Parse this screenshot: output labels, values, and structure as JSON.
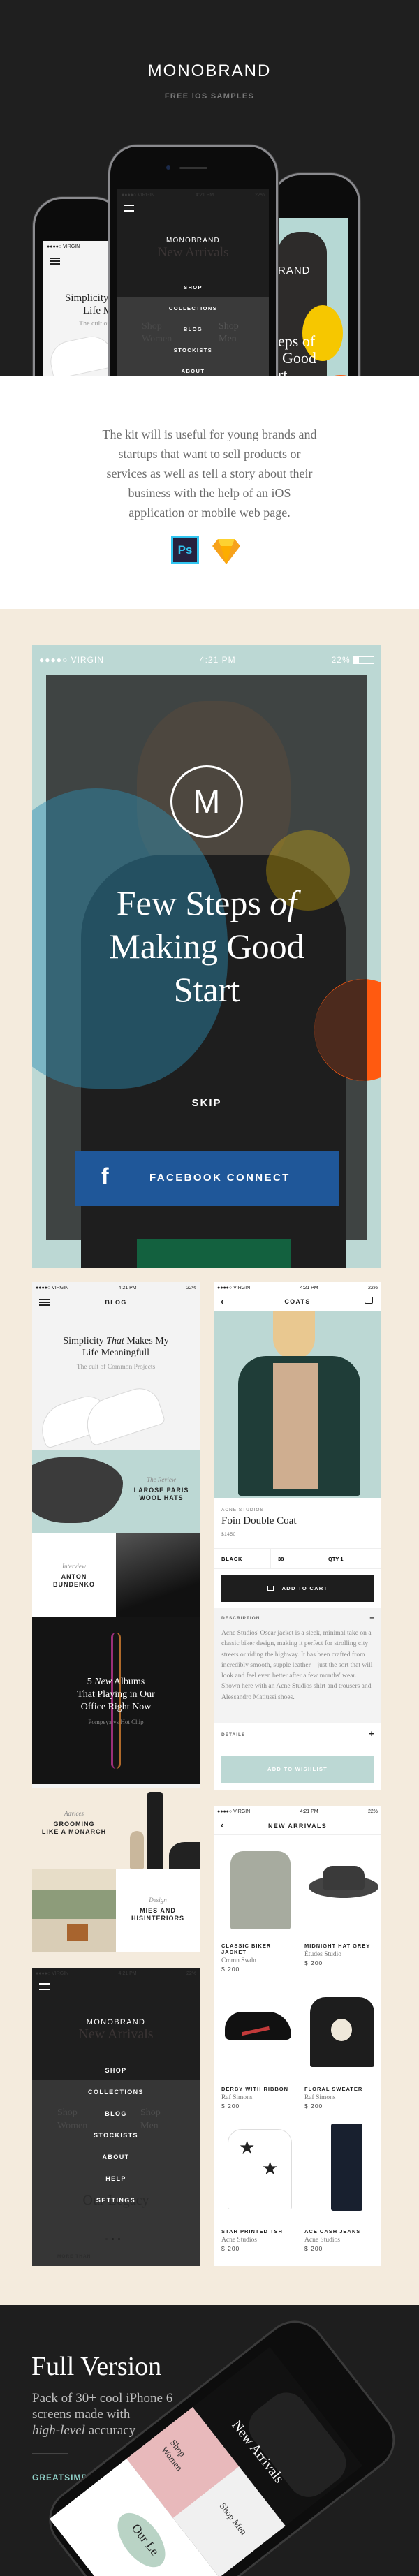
{
  "status_bar": {
    "carrier": "●●●●○ VIRGIN",
    "time": "4:21 PM",
    "battery": "22%"
  },
  "hero": {
    "title": "MONOBRAND",
    "subtitle": "FREE iOS SAMPLES",
    "center_phone": {
      "brand": "MONOBRAND",
      "ghost_heading": "New Arrivals",
      "ghost_shop_women": "Shop Women",
      "ghost_shop_men": "Shop Men",
      "menu": [
        "SHOP",
        "COLLECTIONS",
        "BLOG",
        "STOCKISTS",
        "ABOUT"
      ]
    },
    "left_phone": {
      "line1": "Simplicity",
      "line2": "Life M",
      "subtitle": "The cult of"
    },
    "right_phone": {
      "brand_fragment": "RAND",
      "line1": "eps of",
      "line2": "Good",
      "line3": "rt"
    }
  },
  "intro": {
    "lines": [
      "The kit will is useful for young brands and",
      "startups that want to sell products or",
      "services as well as tell a story about their",
      "business with the help of an iOS",
      "application or mobile web page."
    ],
    "tools": [
      {
        "label": "Ps",
        "icon": "photoshop-icon",
        "color": "#31c5f0"
      },
      {
        "label": "",
        "icon": "sketch-icon",
        "color": "#f7a21b"
      }
    ]
  },
  "splash": {
    "logo": "M",
    "title_line1": "Few Steps",
    "title_italic": "of",
    "title_line2": "Making Good",
    "title_line3": "Start",
    "skip": "SKIP",
    "facebook_icon": "f",
    "facebook_label": "FACEBOOK CONNECT",
    "colors": {
      "teal": "#bcd8d4",
      "facebook": "#1f5799",
      "blue": "#3a9bbd",
      "yellow": "#f6c700",
      "orange": "#ff5a10"
    }
  },
  "blog": {
    "nav_title": "BLOG",
    "hero_title_a": "Simplicity",
    "hero_title_italic": "That",
    "hero_title_b": "Makes My",
    "hero_title_c": "Life Meaningfull",
    "hero_subtitle": "The cult of Common Projects",
    "review": {
      "tag": "The Review",
      "title_1": "LAROSE PARIS",
      "title_2": "WOOL HATS"
    },
    "interview": {
      "tag": "Interview",
      "title_1": "ANTON",
      "title_2": "BUNDENKO"
    },
    "albums": {
      "num": "5",
      "italic": "New",
      "rest": "Albums",
      "line2": "That Playing in Our",
      "line3": "Office Right Now",
      "subtitle": "Pompeya vs Hot Chip"
    },
    "advices": {
      "tag": "Advices",
      "title_1": "GROOMING",
      "title_2": "LIKE A MONARCH"
    },
    "design": {
      "tag": "Design",
      "title_1": "MIES AND",
      "title_2": "HISINTERIORS"
    }
  },
  "menu_screen": {
    "brand": "MONOBRAND",
    "ghost_heading": "New Arrivals",
    "ghost_shop_women": "Shop Women",
    "ghost_shop_men": "Shop Men",
    "ghost_legacy": "Our Legacy",
    "ghost_more": "MORE THAN",
    "items": [
      "SHOP",
      "COLLECTIONS",
      "BLOG",
      "STOCKISTS",
      "ABOUT",
      "HELP",
      "SETTINGS"
    ]
  },
  "product": {
    "nav_title": "COATS",
    "brand": "ACNE STUDIOS",
    "name": "Foin Double Coat",
    "price": "$1450",
    "color": "BLACK",
    "size": "38",
    "qty": "QTY 1",
    "add_to_cart": "ADD TO CART",
    "description_label": "DESCRIPTION",
    "description": "Acne Studios' Oscar jacket is a sleek, minimal take on a classic biker design, making it perfect for strolling city streets or riding the highway. It has been crafted from incredibly smooth, supple leather – just the sort that will look and feel even better after a few months' wear. Shown here with an Acne Studios shirt and trousers and Alessandro Matiussi shoes.",
    "collapse_symbol": "–",
    "details_label": "DETAILS",
    "expand_symbol": "+",
    "wishlist": "ADD TO WISHLIST"
  },
  "arrivals": {
    "nav_title": "NEW ARRIVALS",
    "products": [
      {
        "name": "CLASSIC BIKER JACKET",
        "brand": "Cmmn Swdn",
        "price": "$ 200"
      },
      {
        "name": "MIDNIGHT HAT GREY",
        "brand": "Études Studio",
        "price": "$ 200"
      },
      {
        "name": "DERBY WITH RIBBON",
        "brand": "Raf Simons",
        "price": "$ 200"
      },
      {
        "name": "FLORAL SWEATER",
        "brand": "Raf Simons",
        "price": "$ 200"
      },
      {
        "name": "STAR PRINTED TSH",
        "brand": "Acne Studios",
        "price": "$ 200"
      },
      {
        "name": "ACE CASH JEANS",
        "brand": "Acne Studios",
        "price": "$ 200"
      }
    ]
  },
  "footer": {
    "title": "Full Version",
    "line1": "Pack of 30+ cool iPhone 6",
    "line2": "screens made with",
    "line3_italic": "high-level",
    "line3_rest": "accuracy",
    "url": "GREATSIMPLE.RU/MONOBRAND-IOS",
    "phone_heading": "New Arrivals",
    "phone_shop_men": "Shop Men",
    "phone_shop_women": "Shop Women",
    "phone_legacy": "Our Le",
    "url_color": "#8fd0c8"
  }
}
